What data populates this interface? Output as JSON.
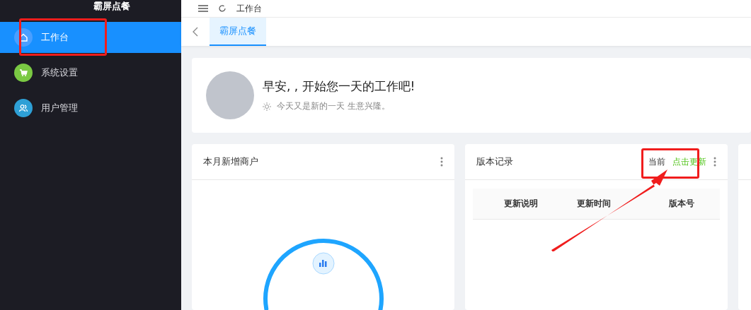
{
  "sidebar": {
    "logo": "霸屏点餐",
    "items": [
      {
        "label": "工作台",
        "kind": "home",
        "color": "#4a9fff",
        "selected": true
      },
      {
        "label": "系统设置",
        "kind": "cart",
        "color": "#7ac943",
        "selected": false
      },
      {
        "label": "用户管理",
        "kind": "users",
        "color": "#2ea0d6",
        "selected": false
      }
    ]
  },
  "header": {
    "breadcrumb": "工作台"
  },
  "tabs": [
    {
      "label": "霸屏点餐",
      "selected": true
    }
  ],
  "welcome": {
    "greeting": "早安, , 开始您一天的工作吧!",
    "subtitle": "今天又是新的一天 生意兴隆。"
  },
  "cards": [
    {
      "kind": "ring",
      "title": "本月新增商户"
    },
    {
      "kind": "table",
      "title": "版本记录",
      "current_label": "当前",
      "update_link": "点击更新",
      "columns": [
        "更新说明",
        "更新时间",
        "版本号"
      ]
    },
    {
      "kind": "blank"
    }
  ]
}
